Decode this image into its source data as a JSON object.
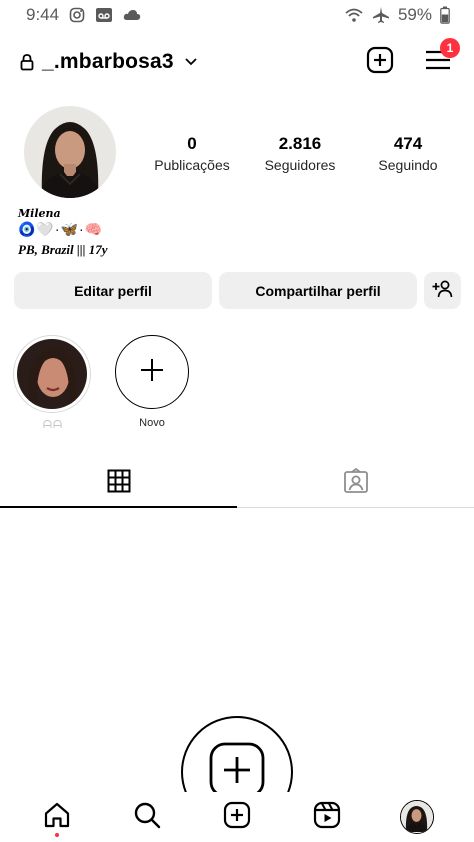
{
  "status_bar": {
    "time": "9:44",
    "battery": "59%",
    "icons": [
      "instagram-icon",
      "voicemail-icon",
      "cloud-icon",
      "wifi-icon",
      "airplane-icon",
      "battery-icon"
    ]
  },
  "header": {
    "username": "_.mbarbosa3",
    "notification_count": "1",
    "icons": [
      "lock-icon",
      "chevron-down-icon",
      "new-post-icon",
      "menu-icon"
    ]
  },
  "profile": {
    "stats": [
      {
        "value": "0",
        "label": "Publicações"
      },
      {
        "value": "2.816",
        "label": "Seguidores"
      },
      {
        "value": "474",
        "label": "Seguindo"
      }
    ],
    "bio": {
      "name": "𝑴𝒊𝒍𝒆𝒏𝒂",
      "emojis": "🧿🤍·🦋·🧠",
      "location": "PB, Brazil ||| 17y"
    }
  },
  "buttons": {
    "edit": "Editar perfil",
    "share": "Compartilhar perfil"
  },
  "highlights": [
    {
      "label": "ᗩᗩ"
    },
    {
      "label": "Novo"
    }
  ],
  "tabs": [
    "grid-icon",
    "tagged-icon"
  ],
  "bottom_nav": [
    "home-icon",
    "search-icon",
    "create-icon",
    "reels-icon",
    "profile-icon"
  ],
  "colors": {
    "accent_red": "#ff3040",
    "button_bg": "#efefef",
    "divider": "#dbdbdb"
  }
}
